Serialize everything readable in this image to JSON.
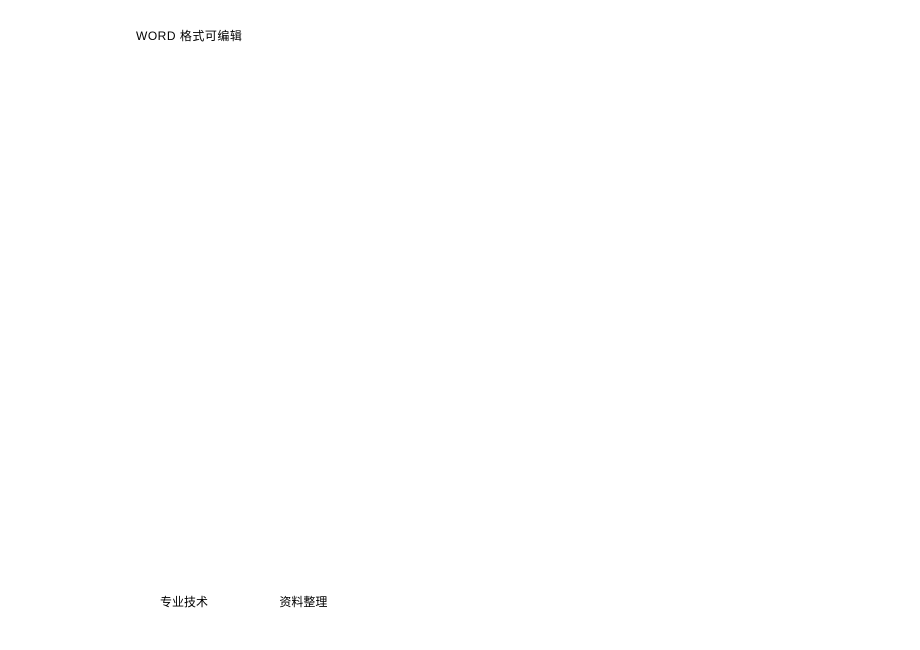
{
  "header": {
    "word_prefix": "WORD",
    "editable_text": " 格式可编辑"
  },
  "footer": {
    "left_text": "专业技术",
    "right_text": "资料整理"
  }
}
